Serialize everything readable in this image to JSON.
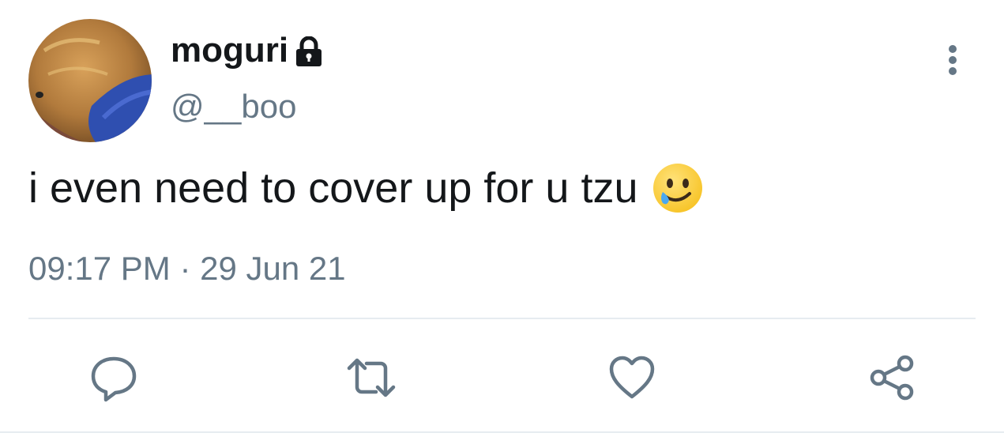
{
  "user": {
    "display_name": "moguri",
    "handle": "@__boo",
    "protected_icon": "lock-icon"
  },
  "tweet": {
    "text": "i even need to cover up for u tzu",
    "emoji": "smiling-face-with-tear",
    "timestamp": "09:17 PM · 29 Jun 21"
  },
  "actions": {
    "reply_icon": "reply-icon",
    "retweet_icon": "retweet-icon",
    "like_icon": "like-icon",
    "share_icon": "share-icon"
  },
  "menu": {
    "icon": "more-vertical-icon"
  },
  "colors": {
    "primary_text": "#14171a",
    "secondary_text": "#657786",
    "divider": "#e6ecf0"
  }
}
